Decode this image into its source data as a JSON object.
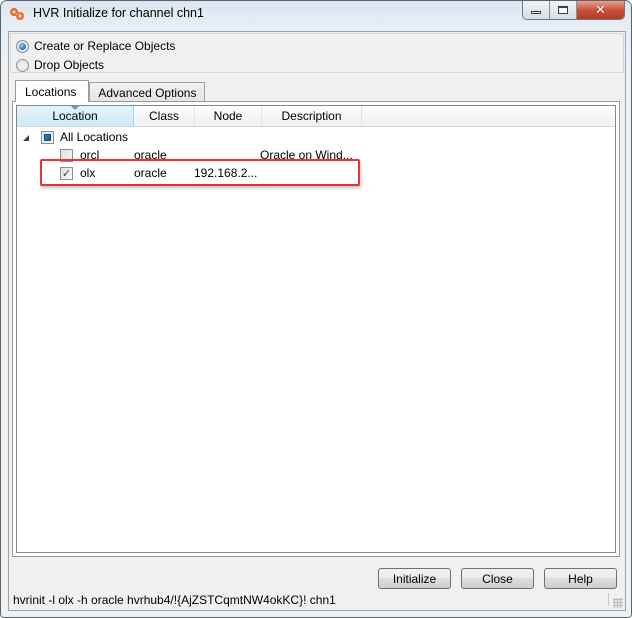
{
  "window": {
    "title": "HVR Initialize for channel chn1",
    "icon": "hvr-app-icon",
    "controls": {
      "minimize": "minimize-icon",
      "maximize": "maximize-icon",
      "close": "✕"
    }
  },
  "mode": {
    "options": [
      {
        "label": "Create or Replace Objects",
        "selected": true
      },
      {
        "label": "Drop Objects",
        "selected": false
      }
    ]
  },
  "tabs": [
    {
      "label": "Locations",
      "active": true
    },
    {
      "label": "Advanced Options",
      "active": false
    }
  ],
  "locations_table": {
    "columns": [
      {
        "label": "Location",
        "sorted": true
      },
      {
        "label": "Class",
        "sorted": false
      },
      {
        "label": "Node",
        "sorted": false
      },
      {
        "label": "Description",
        "sorted": false
      }
    ],
    "root": {
      "label": "All Locations",
      "expanded": true,
      "check_state": "partial"
    },
    "rows": [
      {
        "location": "orcl",
        "class": "oracle",
        "node": "",
        "description": "Oracle on Wind...",
        "checked": false,
        "highlighted": false
      },
      {
        "location": "olx",
        "class": "oracle",
        "node": "192.168.2...",
        "description": "",
        "checked": true,
        "highlighted": true
      }
    ]
  },
  "highlight_color": "#e0383a",
  "buttons": {
    "initialize": "Initialize",
    "close": "Close",
    "help": "Help"
  },
  "status_bar": {
    "command": "hvrinit -l olx -h oracle hvrhub4/!{AjZSTCqmtNW4okKC}! chn1"
  }
}
